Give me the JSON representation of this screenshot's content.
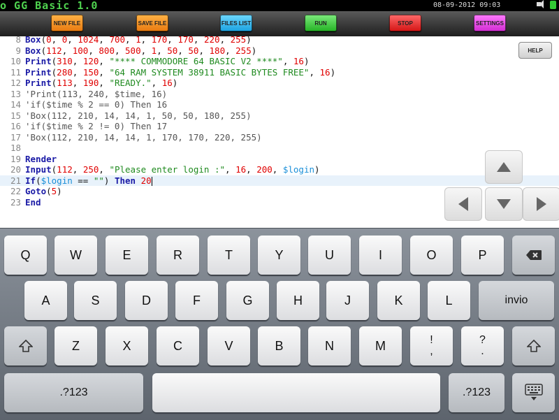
{
  "app": {
    "title": "o GG Basic 1.0",
    "datetime": "08-09-2012 09:03",
    "status_icons": [
      "speaker-icon",
      "battery-icon"
    ],
    "accent_color": "#4fd24f"
  },
  "toolbar": {
    "new_file": "NEW FILE",
    "save_file": "SAVE FILE",
    "files_list": "FILES LIST",
    "run": "RUN",
    "stop": "STOP",
    "settings": "SETTINGS"
  },
  "editor": {
    "help": "HELP",
    "active_line": 21,
    "lines": [
      {
        "n": "8",
        "tokens": [
          {
            "c": "kw",
            "t": "Box"
          },
          {
            "c": "tx",
            "t": "("
          },
          {
            "c": "num",
            "t": "0"
          },
          {
            "c": "tx",
            "t": ", "
          },
          {
            "c": "num",
            "t": "0"
          },
          {
            "c": "tx",
            "t": ", "
          },
          {
            "c": "num",
            "t": "1024"
          },
          {
            "c": "tx",
            "t": ", "
          },
          {
            "c": "num",
            "t": "700"
          },
          {
            "c": "tx",
            "t": ", "
          },
          {
            "c": "num",
            "t": "1"
          },
          {
            "c": "tx",
            "t": ", "
          },
          {
            "c": "num",
            "t": "170"
          },
          {
            "c": "tx",
            "t": ", "
          },
          {
            "c": "num",
            "t": "170"
          },
          {
            "c": "tx",
            "t": ", "
          },
          {
            "c": "num",
            "t": "220"
          },
          {
            "c": "tx",
            "t": ", "
          },
          {
            "c": "num",
            "t": "255"
          },
          {
            "c": "tx",
            "t": ")"
          }
        ]
      },
      {
        "n": "9",
        "tokens": [
          {
            "c": "kw",
            "t": "Box"
          },
          {
            "c": "tx",
            "t": "("
          },
          {
            "c": "num",
            "t": "112"
          },
          {
            "c": "tx",
            "t": ", "
          },
          {
            "c": "num",
            "t": "100"
          },
          {
            "c": "tx",
            "t": ", "
          },
          {
            "c": "num",
            "t": "800"
          },
          {
            "c": "tx",
            "t": ", "
          },
          {
            "c": "num",
            "t": "500"
          },
          {
            "c": "tx",
            "t": ", "
          },
          {
            "c": "num",
            "t": "1"
          },
          {
            "c": "tx",
            "t": ", "
          },
          {
            "c": "num",
            "t": "50"
          },
          {
            "c": "tx",
            "t": ", "
          },
          {
            "c": "num",
            "t": "50"
          },
          {
            "c": "tx",
            "t": ", "
          },
          {
            "c": "num",
            "t": "180"
          },
          {
            "c": "tx",
            "t": ", "
          },
          {
            "c": "num",
            "t": "255"
          },
          {
            "c": "tx",
            "t": ")"
          }
        ]
      },
      {
        "n": "10",
        "tokens": [
          {
            "c": "kw",
            "t": "Print"
          },
          {
            "c": "tx",
            "t": "("
          },
          {
            "c": "num",
            "t": "310"
          },
          {
            "c": "tx",
            "t": ", "
          },
          {
            "c": "num",
            "t": "120"
          },
          {
            "c": "tx",
            "t": ", "
          },
          {
            "c": "str",
            "t": "\"**** COMMODORE 64 BASIC V2 ****\""
          },
          {
            "c": "tx",
            "t": ", "
          },
          {
            "c": "num",
            "t": "16"
          },
          {
            "c": "tx",
            "t": ")"
          }
        ]
      },
      {
        "n": "11",
        "tokens": [
          {
            "c": "kw",
            "t": "Print"
          },
          {
            "c": "tx",
            "t": "("
          },
          {
            "c": "num",
            "t": "280"
          },
          {
            "c": "tx",
            "t": ", "
          },
          {
            "c": "num",
            "t": "150"
          },
          {
            "c": "tx",
            "t": ", "
          },
          {
            "c": "str",
            "t": "\"64 RAM SYSTEM 38911 BASIC BYTES FREE\""
          },
          {
            "c": "tx",
            "t": ", "
          },
          {
            "c": "num",
            "t": "16"
          },
          {
            "c": "tx",
            "t": ")"
          }
        ]
      },
      {
        "n": "12",
        "tokens": [
          {
            "c": "kw",
            "t": "Print"
          },
          {
            "c": "tx",
            "t": "("
          },
          {
            "c": "num",
            "t": "113"
          },
          {
            "c": "tx",
            "t": ", "
          },
          {
            "c": "num",
            "t": "190"
          },
          {
            "c": "tx",
            "t": ", "
          },
          {
            "c": "str",
            "t": "\"READY.\""
          },
          {
            "c": "tx",
            "t": ", "
          },
          {
            "c": "num",
            "t": "16"
          },
          {
            "c": "tx",
            "t": ")"
          }
        ]
      },
      {
        "n": "13",
        "tokens": [
          {
            "c": "cm",
            "t": "'Print(113, 240, $time, 16)"
          }
        ]
      },
      {
        "n": "14",
        "tokens": [
          {
            "c": "cm",
            "t": "'if($time % 2 == 0) Then 16"
          }
        ]
      },
      {
        "n": "15",
        "tokens": [
          {
            "c": "cm",
            "t": "'Box(112, 210, 14, 14, 1, 50, 50, 180, 255)"
          }
        ]
      },
      {
        "n": "16",
        "tokens": [
          {
            "c": "cm",
            "t": "'if($time % 2 != 0) Then 17"
          }
        ]
      },
      {
        "n": "17",
        "tokens": [
          {
            "c": "cm",
            "t": "'Box(112, 210, 14, 14, 1, 170, 170, 220, 255)"
          }
        ]
      },
      {
        "n": "18",
        "tokens": []
      },
      {
        "n": "19",
        "tokens": [
          {
            "c": "kw",
            "t": "Render"
          }
        ]
      },
      {
        "n": "20",
        "tokens": [
          {
            "c": "kw",
            "t": "Input"
          },
          {
            "c": "tx",
            "t": "("
          },
          {
            "c": "num",
            "t": "112"
          },
          {
            "c": "tx",
            "t": ", "
          },
          {
            "c": "num",
            "t": "250"
          },
          {
            "c": "tx",
            "t": ", "
          },
          {
            "c": "str",
            "t": "\"Please enter login :\""
          },
          {
            "c": "tx",
            "t": ", "
          },
          {
            "c": "num",
            "t": "16"
          },
          {
            "c": "tx",
            "t": ", "
          },
          {
            "c": "num",
            "t": "200"
          },
          {
            "c": "tx",
            "t": ", "
          },
          {
            "c": "var",
            "t": "$login"
          },
          {
            "c": "tx",
            "t": ")"
          }
        ]
      },
      {
        "n": "21",
        "tokens": [
          {
            "c": "kw",
            "t": "If"
          },
          {
            "c": "tx",
            "t": "("
          },
          {
            "c": "var",
            "t": "$login"
          },
          {
            "c": "tx",
            "t": " == "
          },
          {
            "c": "str",
            "t": "\"\""
          },
          {
            "c": "tx",
            "t": ") "
          },
          {
            "c": "kw",
            "t": "Then"
          },
          {
            "c": "tx",
            "t": " "
          },
          {
            "c": "num",
            "t": "20"
          }
        ]
      },
      {
        "n": "22",
        "tokens": [
          {
            "c": "kw",
            "t": "Goto"
          },
          {
            "c": "tx",
            "t": "("
          },
          {
            "c": "num",
            "t": "5"
          },
          {
            "c": "tx",
            "t": ")"
          }
        ]
      },
      {
        "n": "23",
        "tokens": [
          {
            "c": "kw",
            "t": "End"
          }
        ]
      }
    ]
  },
  "arrows": [
    "arrow-up-icon",
    "arrow-left-icon",
    "arrow-down-icon",
    "arrow-right-icon"
  ],
  "keyboard": {
    "row1": [
      "Q",
      "W",
      "E",
      "R",
      "T",
      "Y",
      "U",
      "I",
      "O",
      "P"
    ],
    "row2": [
      "A",
      "S",
      "D",
      "F",
      "G",
      "H",
      "J",
      "K",
      "L"
    ],
    "enter": "invio",
    "row3": [
      "Z",
      "X",
      "C",
      "V",
      "B",
      "N",
      "M"
    ],
    "punct1": [
      "!",
      ","
    ],
    "punct2": [
      "?",
      "."
    ],
    "numbers": ".?123",
    "numbers_right": ".?123"
  }
}
